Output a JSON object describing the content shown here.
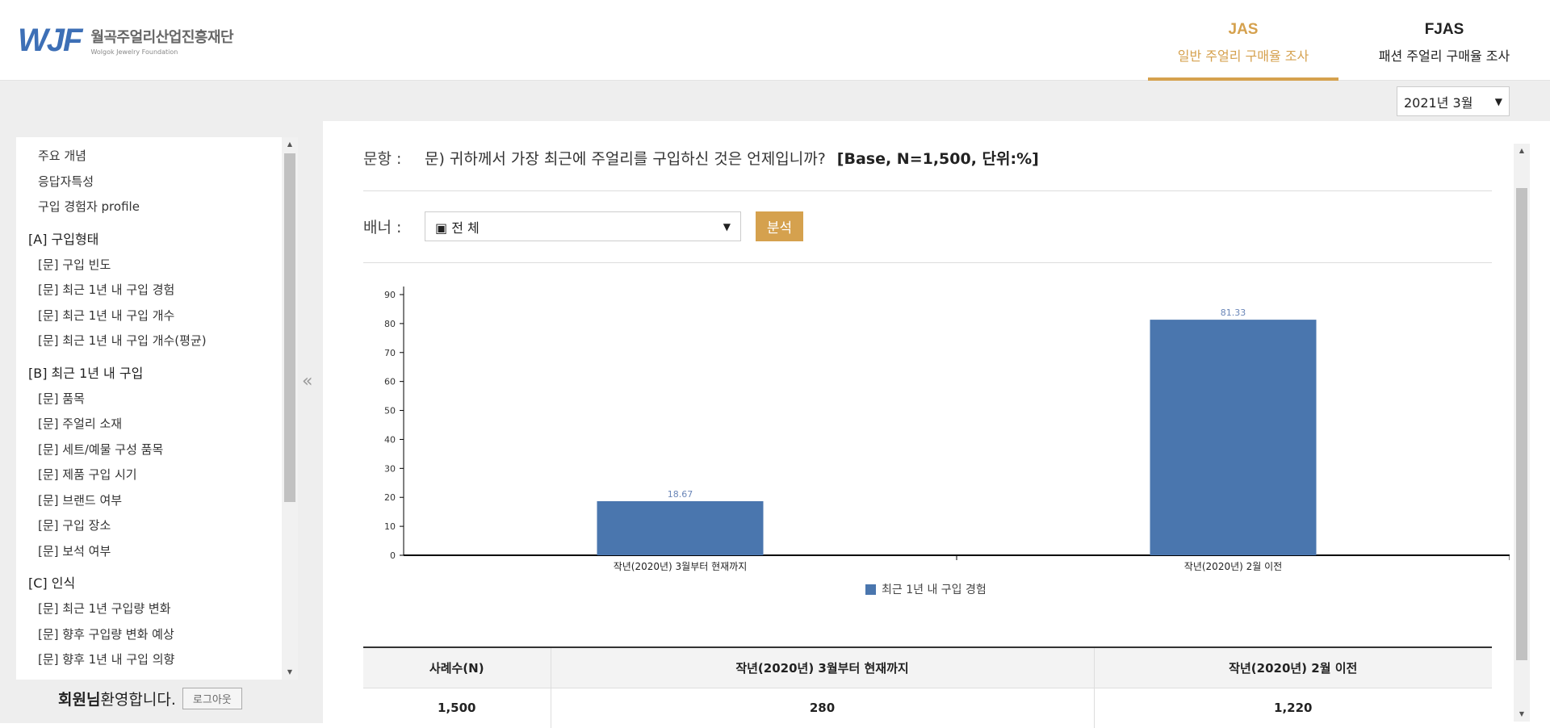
{
  "header": {
    "logo_mark": "WJF",
    "logo_ko": "월곡주얼리산업진흥재단",
    "logo_en": "Wolgok Jewelry Foundation",
    "tabs": [
      {
        "code": "JAS",
        "label": "일반 주얼리 구매율 조사",
        "active": true
      },
      {
        "code": "FJAS",
        "label": "패션 주얼리 구매율 조사",
        "active": false
      }
    ]
  },
  "month_select": {
    "value": "2021년 3월"
  },
  "sidebar": {
    "top_items": [
      "주요 개념",
      "응답자특성",
      "구입 경험자 profile"
    ],
    "groups": [
      {
        "title": "[A] 구입형태",
        "items": [
          "[문] 구입 빈도",
          "[문] 최근 1년 내 구입 경험",
          "[문] 최근 1년 내 구입 개수",
          "[문] 최근 1년 내 구입 개수(평균)"
        ]
      },
      {
        "title": "[B] 최근 1년 내 구입",
        "items": [
          "[문] 품목",
          "[문] 주얼리 소재",
          "[문] 세트/예물 구성 품목",
          "[문] 제품 구입 시기",
          "[문] 브랜드 여부",
          "[문] 구입 장소",
          "[문] 보석 여부"
        ]
      },
      {
        "title": "[C] 인식",
        "items": [
          "[문] 최근 1년 구입량 변화",
          "[문] 향후 구입량 변화 예상",
          "[문] 향후 1년 내 구입 의향"
        ]
      }
    ],
    "welcome_name": "회원님",
    "welcome_text": " 환영합니다.",
    "logout_label": "로그아웃",
    "collapse_icon": "«"
  },
  "main": {
    "question_label": "문항 :",
    "question_text": "문) 귀하께서 가장 최근에 주얼리를 구입하신 것은 언제입니까?",
    "question_base": "[Base, N=1,500, 단위:%]",
    "banner_label": "배너 :",
    "banner_value": "▣ 전 체",
    "analyze_label": "분석"
  },
  "chart_data": {
    "type": "bar",
    "categories": [
      "작년(2020년) 3월부터 현재까지",
      "작년(2020년) 2월 이전"
    ],
    "series": [
      {
        "name": "최근 1년 내 구입 경험",
        "values": [
          18.67,
          81.33
        ],
        "color": "#4a76ae"
      }
    ],
    "ylim": [
      0,
      90
    ],
    "yticks": [
      0,
      10,
      20,
      30,
      40,
      50,
      60,
      70,
      80,
      90
    ],
    "data_label_color": "#6a86b8"
  },
  "table": {
    "headers": [
      "사례수(N)",
      "작년(2020년) 3월부터 현재까지",
      "작년(2020년) 2월 이전"
    ],
    "rows": [
      [
        "1,500",
        "280",
        "1,220"
      ]
    ]
  }
}
